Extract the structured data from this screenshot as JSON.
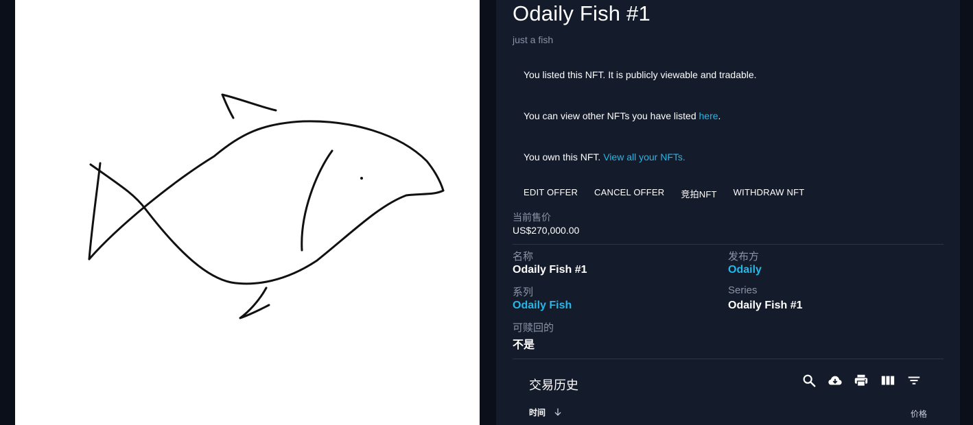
{
  "nft": {
    "title": "Odaily Fish #1",
    "description": "just a fish",
    "image_alt": "hand-drawn fish sketch"
  },
  "notices": {
    "listed": "You listed this NFT. It is publicly viewable and tradable.",
    "view_other_prefix": "You can view other NFTs you have listed ",
    "view_other_link": "here",
    "view_other_suffix": ".",
    "own_prefix": "You own this NFT. ",
    "own_link": "View all your NFTs."
  },
  "actions": {
    "edit_offer": "EDIT OFFER",
    "cancel_offer": "CANCEL OFFER",
    "auction": "竞拍NFT",
    "withdraw": "WITHDRAW NFT"
  },
  "price": {
    "label": "当前售价",
    "value": "US$270,000.00"
  },
  "properties": {
    "name_label": "名称",
    "name_value": "Odaily Fish #1",
    "issuer_label": "发布方",
    "issuer_value": "Odaily",
    "collection_label": "系列",
    "collection_value": "Odaily Fish",
    "series_label": "Series",
    "series_value": "Odaily Fish #1",
    "redeemable_label": "可赎回的",
    "redeemable_value": "不是"
  },
  "history": {
    "title": "交易历史",
    "col_time": "时间",
    "col_price": "价格",
    "toolbar_icons": [
      "search-icon",
      "cloud-download-icon",
      "print-icon",
      "view-column-icon",
      "filter-icon"
    ]
  },
  "colors": {
    "panel_bg": "#141b2b",
    "page_bg": "#0b0f1a",
    "link": "#29b6e6",
    "muted": "#8a94a6"
  }
}
